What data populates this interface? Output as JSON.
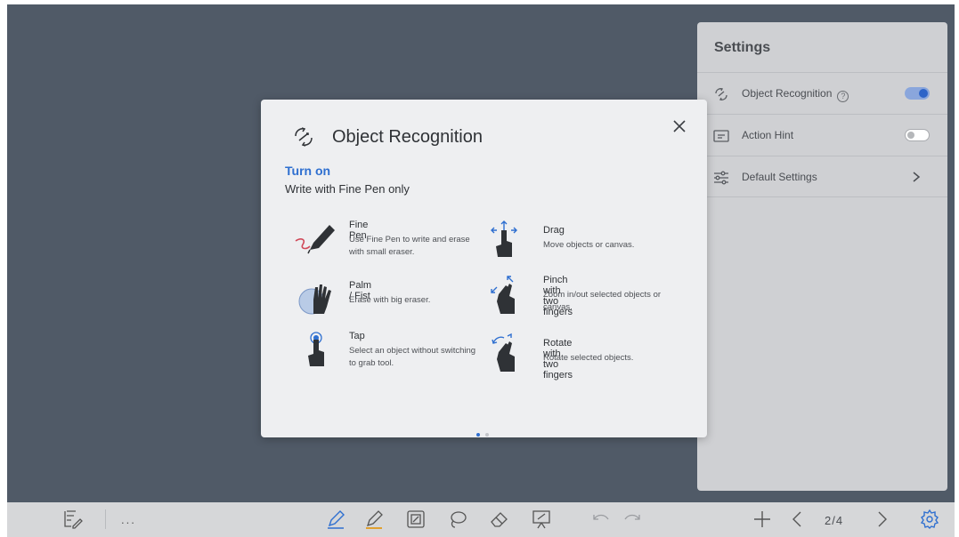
{
  "settings": {
    "title": "Settings",
    "rows": [
      {
        "label": "Object Recognition",
        "help": "?",
        "toggle": "on"
      },
      {
        "label": "Action Hint",
        "toggle": "off"
      },
      {
        "label": "Default Settings"
      }
    ]
  },
  "dialog": {
    "title": "Object Recognition",
    "turn_on": "Turn on",
    "subtitle": "Write with Fine Pen only",
    "gestures": [
      {
        "title": "Fine Pen",
        "desc": "Use Fine Pen to write and erase with small eraser.",
        "icon": "pen-icon"
      },
      {
        "title": "Palm / Fist",
        "desc": "Erase with big eraser.",
        "icon": "palm-icon"
      },
      {
        "title": "Tap",
        "desc": "Select an object without switching to grab tool.",
        "icon": "tap-icon"
      },
      {
        "title": "Drag",
        "desc": "Move objects or canvas.",
        "icon": "drag-icon"
      },
      {
        "title": "Pinch with two fingers",
        "desc": "Zoom in/out selected objects or canvas.",
        "icon": "pinch-icon"
      },
      {
        "title": "Rotate with two fingers",
        "desc": "Rotate selected objects.",
        "icon": "rotate-icon"
      }
    ],
    "page_indicator": {
      "current": 1,
      "total": 2
    }
  },
  "toolbar": {
    "more_label": "...",
    "page": "2/4"
  },
  "colors": {
    "accent": "#2e6fd0",
    "canvas": "#505a67",
    "panel": "#cfd0d3",
    "dialog": "#eeeff1"
  }
}
